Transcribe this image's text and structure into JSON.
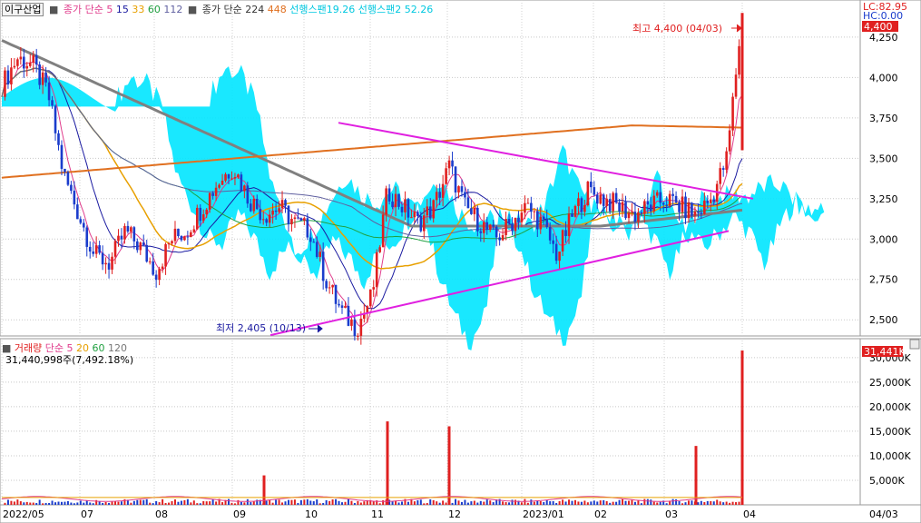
{
  "header": {
    "stock_name": "이구산업",
    "ma_group1_label": "종가 단순",
    "ma_group1_periods": [
      "5",
      "15",
      "33",
      "60",
      "112"
    ],
    "ma_group2_label": "종가 단순",
    "ma_group2_periods": [
      "224",
      "448"
    ],
    "span1_label": "선행스팬1",
    "span1_value": "9.26",
    "span2_label": "선행스팬2",
    "span2_value": "52.26",
    "lc_label": "LC:82.95",
    "hc_label": "HC:0.00"
  },
  "colors": {
    "ma5": "#e03c8c",
    "ma15": "#1a1aa0",
    "ma33": "#e8a000",
    "ma60": "#20a040",
    "ma112": "#6060a0",
    "ma224": "#808080",
    "ma448": "#e07020",
    "cloud": "#00e5ff",
    "trend": "#e020e0",
    "up": "#e02020",
    "down": "#1a3ccc"
  },
  "annotations": {
    "high": "최고 4,400 (04/03)",
    "low": "최저 2,405 (10/13)",
    "current_price": "4,400",
    "volume_current": "31,441K"
  },
  "volume_header": {
    "label": "거래량",
    "ma_label": "단순",
    "ma_periods": [
      "5",
      "20",
      "60",
      "120"
    ],
    "stats": "31,440,998주(7,492.18%)"
  },
  "chart_data": {
    "type": "candlestick",
    "y_ticks": [
      "4,250",
      "4,000",
      "3,750",
      "3,500",
      "3,250",
      "3,000",
      "2,750",
      "2,500"
    ],
    "ylim": [
      2400,
      4480
    ],
    "x_labels": [
      "2022/05",
      "07",
      "08",
      "09",
      "10",
      "11",
      "12",
      "2023/01",
      "02",
      "03",
      "04"
    ],
    "right_x_label": "04/03",
    "volume_ticks": [
      "30,000K",
      "25,000K",
      "20,000K",
      "15,000K",
      "10,000K",
      "5,000K"
    ],
    "volume_ylim": [
      0,
      32000
    ],
    "price_series": [
      {
        "d": "05-02",
        "c": 3950
      },
      {
        "d": "05-09",
        "c": 4120
      },
      {
        "d": "05-16",
        "c": 4080
      },
      {
        "d": "05-23",
        "c": 3900
      },
      {
        "d": "05-30",
        "c": 3400
      },
      {
        "d": "06-06",
        "c": 3150
      },
      {
        "d": "06-13",
        "c": 2900
      },
      {
        "d": "06-20",
        "c": 2850
      },
      {
        "d": "06-27",
        "c": 3050
      },
      {
        "d": "07-04",
        "c": 2950
      },
      {
        "d": "07-11",
        "c": 2800
      },
      {
        "d": "07-18",
        "c": 3000
      },
      {
        "d": "07-25",
        "c": 3050
      },
      {
        "d": "08-01",
        "c": 3200
      },
      {
        "d": "08-08",
        "c": 3350
      },
      {
        "d": "08-15",
        "c": 3450
      },
      {
        "d": "08-22",
        "c": 3250
      },
      {
        "d": "08-29",
        "c": 3150
      },
      {
        "d": "09-05",
        "c": 3200
      },
      {
        "d": "09-12",
        "c": 3100
      },
      {
        "d": "09-19",
        "c": 3050
      },
      {
        "d": "09-26",
        "c": 2750
      },
      {
        "d": "10-03",
        "c": 2550
      },
      {
        "d": "10-10",
        "c": 2450
      },
      {
        "d": "10-17",
        "c": 2650
      },
      {
        "d": "10-24",
        "c": 3300
      },
      {
        "d": "10-31",
        "c": 3200
      },
      {
        "d": "11-07",
        "c": 3100
      },
      {
        "d": "11-14",
        "c": 3200
      },
      {
        "d": "11-21",
        "c": 3450
      },
      {
        "d": "11-28",
        "c": 3200
      },
      {
        "d": "12-05",
        "c": 3100
      },
      {
        "d": "12-12",
        "c": 3000
      },
      {
        "d": "12-19",
        "c": 3100
      },
      {
        "d": "12-26",
        "c": 3200
      },
      {
        "d": "01-02",
        "c": 3100
      },
      {
        "d": "01-09",
        "c": 2900
      },
      {
        "d": "01-16",
        "c": 3150
      },
      {
        "d": "01-23",
        "c": 3300
      },
      {
        "d": "01-30",
        "c": 3250
      },
      {
        "d": "02-06",
        "c": 3200
      },
      {
        "d": "02-13",
        "c": 3150
      },
      {
        "d": "02-20",
        "c": 3200
      },
      {
        "d": "02-27",
        "c": 3250
      },
      {
        "d": "03-06",
        "c": 3200
      },
      {
        "d": "03-13",
        "c": 3150
      },
      {
        "d": "03-20",
        "c": 3250
      },
      {
        "d": "03-27",
        "c": 3500
      },
      {
        "d": "04-03",
        "c": 4400
      }
    ],
    "volume_spikes": [
      {
        "d": "08-29",
        "v": 6000
      },
      {
        "d": "10-24",
        "v": 17000
      },
      {
        "d": "11-21",
        "v": 16000
      },
      {
        "d": "03-13",
        "v": 12000
      },
      {
        "d": "04-03",
        "v": 31441
      }
    ]
  }
}
